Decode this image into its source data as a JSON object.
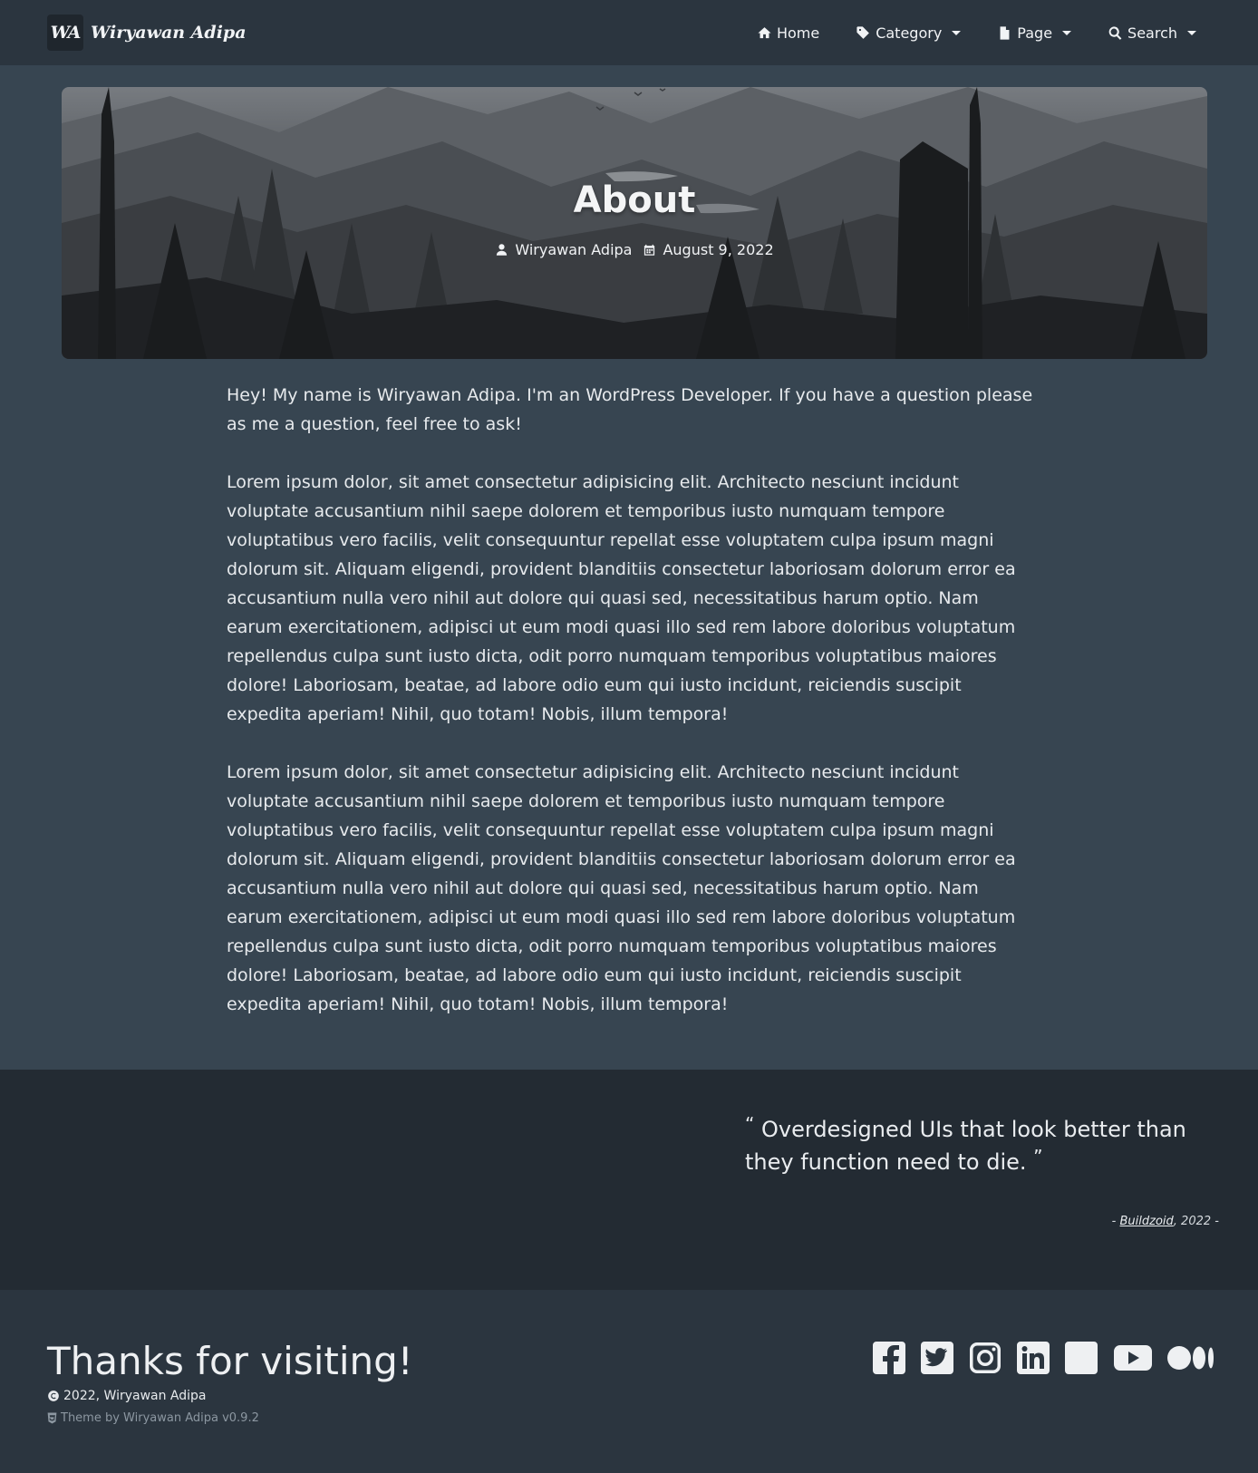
{
  "navbar": {
    "brand_logo": "WA",
    "brand_name": "Wiryawan Adipa",
    "items": [
      {
        "label": "Home",
        "icon": "home-icon",
        "dropdown": false
      },
      {
        "label": "Category",
        "icon": "tag-icon",
        "dropdown": true
      },
      {
        "label": "Page",
        "icon": "file-icon",
        "dropdown": true
      },
      {
        "label": "Search",
        "icon": "search-icon",
        "dropdown": true
      }
    ]
  },
  "hero": {
    "title": "About",
    "author": "Wiryawan Adipa",
    "date": "August 9, 2022"
  },
  "article": {
    "paragraphs": [
      "Hey! My name is Wiryawan Adipa. I'm an WordPress Developer. If you have a question please as me a question, feel free to ask!",
      "Lorem ipsum dolor, sit amet consectetur adipisicing elit. Architecto nesciunt incidunt voluptate accusantium nihil saepe dolorem et temporibus iusto numquam tempore voluptatibus vero facilis, velit consequuntur repellat esse voluptatem culpa ipsum magni dolorum sit. Aliquam eligendi, provident blanditiis consectetur laboriosam dolorum error ea accusantium nulla vero nihil aut dolore qui quasi sed, necessitatibus harum optio. Nam earum exercitationem, adipisci ut eum modi quasi illo sed rem labore doloribus voluptatum repellendus culpa sunt iusto dicta, odit porro numquam temporibus voluptatibus maiores dolore! Laboriosam, beatae, ad labore odio eum qui iusto incidunt, reiciendis suscipit expedita aperiam! Nihil, quo totam! Nobis, illum tempora!",
      "Lorem ipsum dolor, sit amet consectetur adipisicing elit. Architecto nesciunt incidunt voluptate accusantium nihil saepe dolorem et temporibus iusto numquam tempore voluptatibus vero facilis, velit consequuntur repellat esse voluptatem culpa ipsum magni dolorum sit. Aliquam eligendi, provident blanditiis consectetur laboriosam dolorum error ea accusantium nulla vero nihil aut dolore qui quasi sed, necessitatibus harum optio. Nam earum exercitationem, adipisci ut eum modi quasi illo sed rem labore doloribus voluptatum repellendus culpa sunt iusto dicta, odit porro numquam temporibus voluptatibus maiores dolore! Laboriosam, beatae, ad labore odio eum qui iusto incidunt, reiciendis suscipit expedita aperiam! Nihil, quo totam! Nobis, illum tempora!"
    ]
  },
  "quote": {
    "open_mark": "“",
    "text": "Overdesigned UIs that look better than they function need to die.",
    "close_mark": "”",
    "dash_left": "-",
    "author": "Buildzoid",
    "year": ", 2022",
    "dash_right": "-"
  },
  "footer": {
    "thanks": "Thanks for visiting!",
    "copyright": "2022, Wiryawan Adipa",
    "theme_credit": "Theme by Wiryawan Adipa v0.9.2",
    "socials": [
      "facebook-icon",
      "twitter-icon",
      "instagram-icon",
      "linkedin-icon",
      "github-icon",
      "youtube-icon",
      "medium-icon"
    ]
  }
}
